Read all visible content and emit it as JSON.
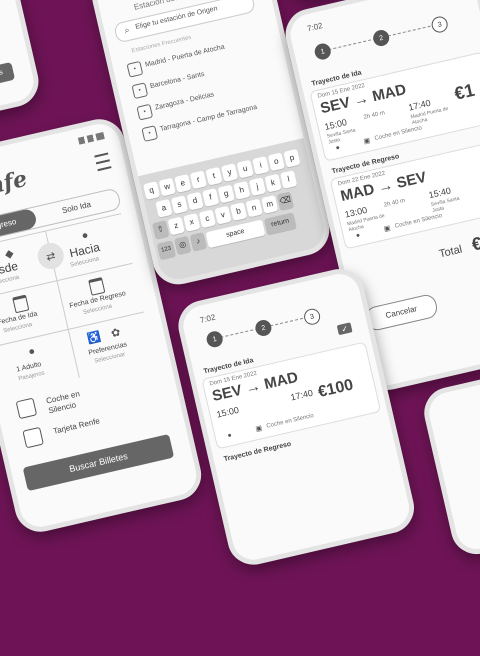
{
  "brand": "renfe",
  "main_form": {
    "tabs": [
      "Regreso",
      "Solo Ida"
    ],
    "desde": {
      "label": "Desde",
      "sub": "Selecciona"
    },
    "hacia": {
      "label": "Hacia",
      "sub": "Selecciona"
    },
    "fecha_ida": {
      "label": "Fecha de Ida",
      "sub": "Selecciona"
    },
    "fecha_regreso": {
      "label": "Fecha de Regreso",
      "sub": "Selecciona"
    },
    "adulto": {
      "label": "1 Adulto",
      "sub": "Pasajeros"
    },
    "preferencias": {
      "label": "Preferencias",
      "sub": "Seleccionar"
    },
    "coche_silencio": "Coche en Silencio",
    "tarjeta_renfe": "Tarjeta Renfe",
    "buscar": "Buscar Billetes"
  },
  "date_phone": {
    "button": "Elegir estas fechas"
  },
  "search_phone": {
    "header": "Estación desde donde viajas",
    "placeholder": "Elige tu estación de Origen",
    "section": "Estaciones Frecuentes",
    "stations": [
      "Madrid - Puerta de Atocha",
      "Barcelona - Sants",
      "Zaragoza - Delicias",
      "Tarragona - Camp de Tarragona"
    ],
    "keyboard": {
      "row1": [
        "q",
        "w",
        "e",
        "r",
        "t",
        "y",
        "u",
        "i",
        "o",
        "p"
      ],
      "row2": [
        "a",
        "s",
        "d",
        "f",
        "g",
        "h",
        "j",
        "k",
        "l"
      ],
      "row3": [
        "z",
        "x",
        "c",
        "v",
        "b",
        "n",
        "m"
      ],
      "num": "123",
      "space": "space",
      "return": "return"
    }
  },
  "trip_phone": {
    "time": "7:02",
    "steps": [
      "1",
      "2",
      "3"
    ],
    "ida": {
      "title": "Trayecto de Ida",
      "date": "Dom 15 Ene 2022",
      "from": "SEV",
      "to": "MAD",
      "dep": "15:00",
      "arr": "17:40",
      "duration": "2h 40 m",
      "dep_station": "Sevilla Santa Justa",
      "arr_station": "Madrid Puerta de Atocha",
      "price": "€1",
      "coche": "Coche en Silencio"
    },
    "regreso": {
      "title": "Trayecto de Regreso",
      "date": "Dom 22 Ene 2022",
      "from": "MAD",
      "to": "SEV",
      "dep": "13:00",
      "arr": "15:40",
      "duration": "2h 40 m",
      "dep_station": "Madrid Puerta de Atocha",
      "arr_station": "Sevilla Santa Justa",
      "coche": "Coche en Silencio"
    },
    "total_label": "Total",
    "total_value": "€2",
    "cancel": "Cancelar"
  },
  "bottom_phone": {
    "time": "7:02",
    "steps": [
      "1",
      "2",
      "3"
    ],
    "ida": {
      "title": "Trayecto de Ida",
      "date": "Dom 15 Ene 2022",
      "from": "SEV",
      "to": "MAD",
      "dep": "15:00",
      "arr": "17:40",
      "price": "€100",
      "coche": "Coche en Silencio"
    },
    "regreso_title": "Trayecto de Regreso"
  }
}
